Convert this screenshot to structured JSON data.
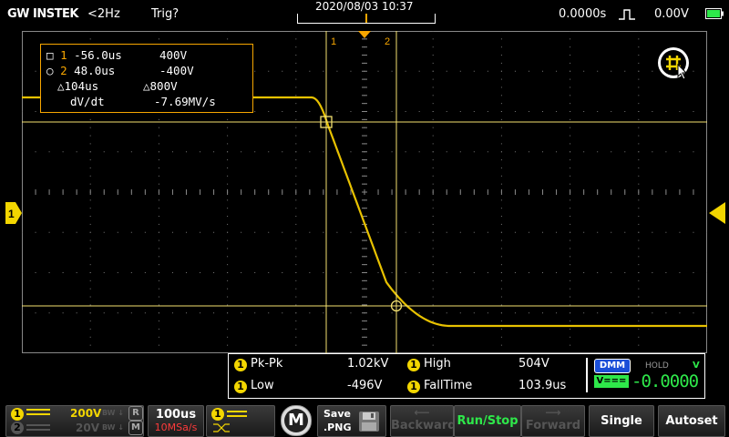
{
  "topbar": {
    "brand": "GW INSTEK",
    "trigger_freq": "<2Hz",
    "trigger_status": "Trig?",
    "datetime": "2020/08/03  10:37",
    "horizontal_position": "0.0000s",
    "trigger_level": "0.00V"
  },
  "cursor_readout": {
    "c1_time": "-56.0us",
    "c1_volt": "400V",
    "c2_time": "48.0us",
    "c2_volt": "-400V",
    "delta_time": "104us",
    "delta_volt": "800V",
    "dvdt_label": "dV/dt",
    "dvdt_value": "-7.69MV/s",
    "c1_index": "1",
    "c2_index": "2"
  },
  "cursor_markers": {
    "left": "1",
    "right": "2"
  },
  "channel_marker": "1",
  "measurements": [
    {
      "label": "Pk-Pk",
      "value": "1.02kV",
      "channel": "1"
    },
    {
      "label": "Low",
      "value": "-496V",
      "channel": "1"
    },
    {
      "label": "High",
      "value": "504V",
      "channel": "1"
    },
    {
      "label": "FallTime",
      "value": "103.9us",
      "channel": "1"
    }
  ],
  "dmm": {
    "badge": "DMM",
    "hold": "HOLD",
    "unit": "V",
    "mode": "V===",
    "value": "-0.0000"
  },
  "bottombar": {
    "ch1_scale": "200V",
    "ch2_scale": "20V",
    "ch_num_1": "1",
    "ch_num_2": "2",
    "timebase": "100us",
    "sample_rate": "10MSa/s",
    "math_label": "M",
    "save_line1": "Save",
    "save_line2": ".PNG",
    "backward": "Backward",
    "runstop": "Run/Stop",
    "forward": "Forward",
    "single": "Single",
    "autoset": "Autoset"
  },
  "colors": {
    "trace": "#e8c200",
    "cursor": "#f3e070",
    "accent": "#f7a600",
    "grid": "#666666",
    "dmm_green": "#2ee84a"
  }
}
